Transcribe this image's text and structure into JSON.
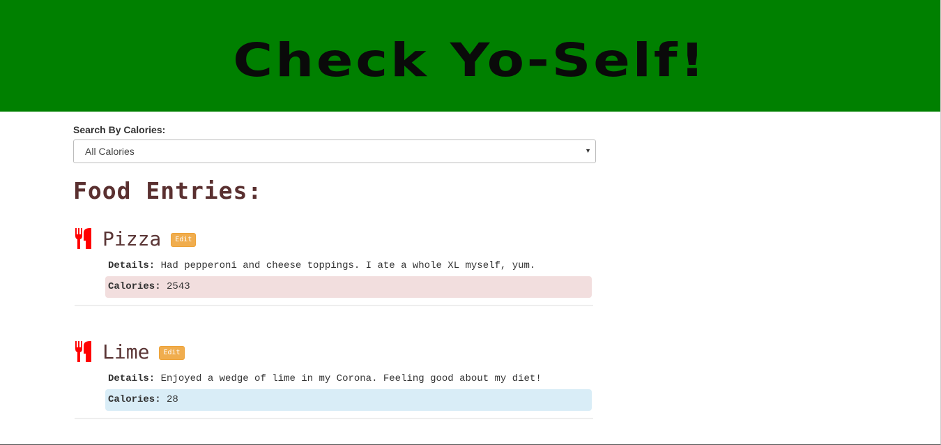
{
  "header": {
    "title": "Check Yo-Self!",
    "background_color": "#008000"
  },
  "search": {
    "label": "Search By Calories:",
    "selected_option": "All Calories"
  },
  "entries_section": {
    "title": "Food Entries:"
  },
  "entries": [
    {
      "name": "Pizza",
      "edit_label": "Edit",
      "details_label": "Details:",
      "details": "Had pepperoni and cheese toppings. I ate a whole XL myself, yum.",
      "calories_label": "Calories:",
      "calories": "2543",
      "calorie_highlight": "#f2dede"
    },
    {
      "name": "Lime",
      "edit_label": "Edit",
      "details_label": "Details:",
      "details": "Enjoyed a wedge of lime in my Corona. Feeling good about my diet!",
      "calories_label": "Calories:",
      "calories": "28",
      "calorie_highlight": "#d9edf7"
    }
  ],
  "icons": {
    "entry_icon": "cutlery-icon",
    "select_caret": "caret-down-icon"
  },
  "colors": {
    "icon": "#ff0000",
    "edit_button": "#f0ad4e",
    "heading_text": "#5a3030"
  }
}
